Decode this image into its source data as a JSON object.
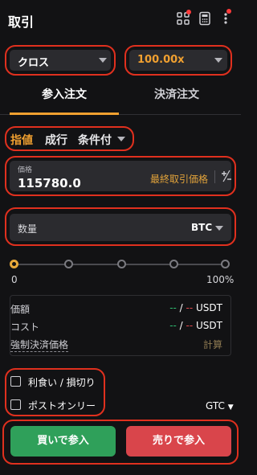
{
  "header": {
    "title": "取引"
  },
  "selectors": {
    "margin_mode": "クロス",
    "leverage": "100.00x"
  },
  "tabs": [
    {
      "label": "参入注文",
      "active": true
    },
    {
      "label": "決済注文",
      "active": false
    }
  ],
  "order_types": {
    "limit": "指値",
    "market": "成行",
    "conditional": "条件付"
  },
  "price_field": {
    "label": "価格",
    "value": "115780.0",
    "last_price_link": "最終取引価格",
    "toggle_glyph": "+∕−"
  },
  "quantity_field": {
    "label": "数量",
    "unit": "BTC"
  },
  "slider": {
    "value_percent": 0,
    "min_label": "0",
    "max_label": "100%"
  },
  "info": {
    "rows": [
      {
        "key": "価額",
        "a": "--",
        "sep": " / ",
        "b": "--",
        "unit": " USDT"
      },
      {
        "key": "コスト",
        "a": "--",
        "sep": " / ",
        "b": "--",
        "unit": " USDT"
      }
    ],
    "liq_label": "強制決済価格",
    "liq_value": "計算"
  },
  "options": {
    "tp_sl": "利食い / 損切り",
    "post_only": "ポストオンリー",
    "time_in_force": "GTC"
  },
  "actions": {
    "buy": "買いで参入",
    "sell": "売りで参入"
  },
  "colors": {
    "accent": "#f0a030",
    "buy": "#2fa05a",
    "sell": "#d9454b",
    "highlight_ring": "#e0301e"
  }
}
